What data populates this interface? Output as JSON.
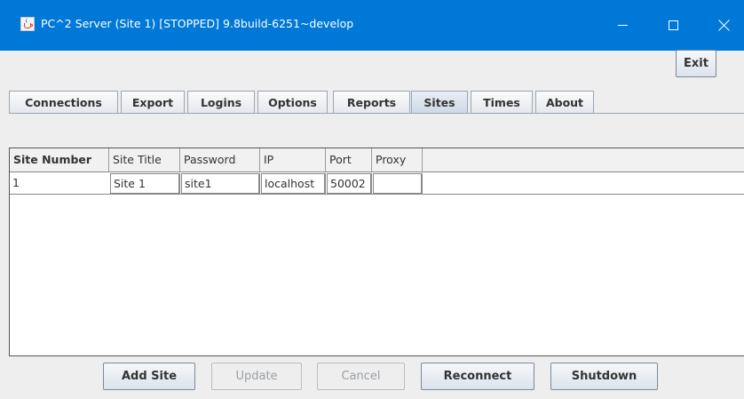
{
  "window": {
    "title": "PC^2 Server (Site 1) [STOPPED] 9.8build-6251~develop",
    "icon": "java-cup-icon",
    "controls": {
      "minimize_icon": "minimize-icon",
      "maximize_icon": "maximize-icon",
      "close_icon": "close-icon"
    },
    "accent": "#0078d7"
  },
  "toolbar": {
    "exit_label": "Exit"
  },
  "tabs": [
    {
      "label": "Connections"
    },
    {
      "label": "Export"
    },
    {
      "label": "Logins"
    },
    {
      "label": "Options"
    },
    {
      "label": "Reports"
    },
    {
      "label": "Sites",
      "selected": true
    },
    {
      "label": "Times"
    },
    {
      "label": "About"
    }
  ],
  "table": {
    "columns": [
      "Site Number",
      "Site Title",
      "Password",
      "IP",
      "Port",
      "Proxy"
    ],
    "rows": [
      {
        "site_number": "1",
        "site_title": "Site 1",
        "password": "site1",
        "ip": "localhost",
        "port": "50002",
        "proxy": ""
      }
    ]
  },
  "actions": {
    "add_site": "Add Site",
    "update": "Update",
    "cancel": "Cancel",
    "reconnect": "Reconnect",
    "shutdown": "Shutdown"
  }
}
